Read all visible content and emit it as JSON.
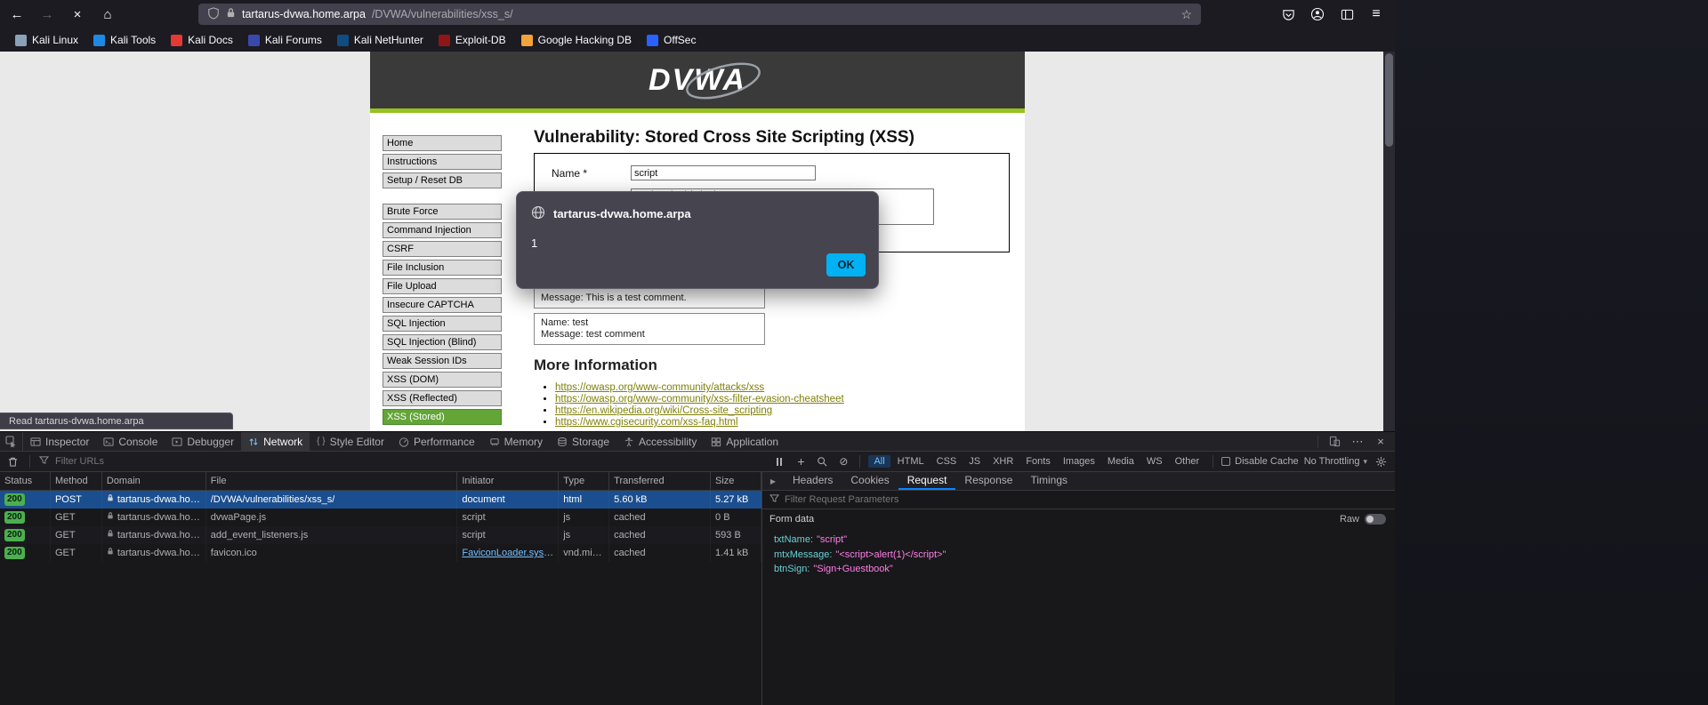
{
  "colors": {
    "accent_blue": "#0a84ff",
    "selected_row_blue": "#1b4e8f",
    "status_green": "#4caf50",
    "dvwa_green": "#97c221",
    "menu_selected_green": "#63a537",
    "link_olive": "#80800a",
    "param_key_teal": "#6ad1d6",
    "param_value_pink": "#ff7de9",
    "ok_button_blue": "#00b2f3"
  },
  "browser": {
    "url": {
      "host": "tartarus-dvwa.home.arpa",
      "path": "/DVWA/vulnerabilities/xss_s/"
    },
    "icons": {
      "back": "←",
      "forward": "→",
      "stop": "×",
      "home": "⌂",
      "star": "☆",
      "menu": "≡"
    },
    "bookmarks": [
      "Kali Linux",
      "Kali Tools",
      "Kali Docs",
      "Kali Forums",
      "Kali NetHunter",
      "Exploit-DB",
      "Google Hacking DB",
      "OffSec"
    ],
    "status_tooltip": "Read tartarus-dvwa.home.arpa"
  },
  "dialog": {
    "origin": "tartarus-dvwa.home.arpa",
    "message": "1",
    "ok_label": "OK"
  },
  "page": {
    "logo_text": "DVWA",
    "heading": "Vulnerability: Stored Cross Site Scripting (XSS)",
    "menu": [
      "Home",
      "Instructions",
      "Setup / Reset DB",
      "Brute Force",
      "Command Injection",
      "CSRF",
      "File Inclusion",
      "File Upload",
      "Insecure CAPTCHA",
      "SQL Injection",
      "SQL Injection (Blind)",
      "Weak Session IDs",
      "XSS (DOM)",
      "XSS (Reflected)",
      "XSS (Stored)"
    ],
    "form": {
      "name_label": "Name *",
      "name_value": "script",
      "message_value": "<script>alert(1)</script>"
    },
    "guestbook": {
      "entry1_line1": "Message: This is a test comment.",
      "entry2_line1": "Name: test",
      "entry2_line2": "Message: test comment"
    },
    "more_info_heading": "More Information",
    "links": [
      "https://owasp.org/www-community/attacks/xss",
      "https://owasp.org/www-community/xss-filter-evasion-cheatsheet",
      "https://en.wikipedia.org/wiki/Cross-site_scripting",
      "https://www.cgisecurity.com/xss-faq.html"
    ]
  },
  "devtools": {
    "icons": {
      "meatball": "⋯",
      "close": "×",
      "caret": "▾",
      "block": "⊘",
      "braces": "{ }",
      "play": "▶"
    },
    "tabs": [
      "Inspector",
      "Console",
      "Debugger",
      "Network",
      "Style Editor",
      "Performance",
      "Memory",
      "Storage",
      "Accessibility",
      "Application"
    ],
    "network": {
      "filter_placeholder": "Filter URLs",
      "filters": [
        "All",
        "HTML",
        "CSS",
        "JS",
        "XHR",
        "Fonts",
        "Images",
        "Media",
        "WS",
        "Other"
      ],
      "disable_cache_label": "Disable Cache",
      "throttling_label": "No Throttling",
      "columns": [
        "Status",
        "Method",
        "Domain",
        "File",
        "Initiator",
        "Type",
        "Transferred",
        "Size"
      ],
      "rows": [
        {
          "status": "200",
          "method": "POST",
          "domain": "tartarus-dvwa.home…",
          "file": "/DVWA/vulnerabilities/xss_s/",
          "initiator": "document",
          "type": "html",
          "transferred": "5.60 kB",
          "size": "5.27 kB"
        },
        {
          "status": "200",
          "method": "GET",
          "domain": "tartarus-dvwa.home…",
          "file": "dvwaPage.js",
          "initiator": "script",
          "type": "js",
          "transferred": "cached",
          "size": "0 B"
        },
        {
          "status": "200",
          "method": "GET",
          "domain": "tartarus-dvwa.home…",
          "file": "add_event_listeners.js",
          "initiator": "script",
          "type": "js",
          "transferred": "cached",
          "size": "593 B"
        },
        {
          "status": "200",
          "method": "GET",
          "domain": "tartarus-dvwa.home…",
          "file": "favicon.ico",
          "initiator": "FaviconLoader.sys.mjs:1…",
          "type": "vnd.micro…",
          "transferred": "cached",
          "size": "1.41 kB"
        }
      ]
    },
    "request_panel": {
      "tabs": [
        "Headers",
        "Cookies",
        "Request",
        "Response",
        "Timings"
      ],
      "filter_placeholder": "Filter Request Parameters",
      "section_label": "Form data",
      "raw_label": "Raw",
      "params": [
        {
          "key": "txtName:",
          "value": "\"script\""
        },
        {
          "key": "mtxMessage:",
          "value": "\"<script>alert(1)</script>\""
        },
        {
          "key": "btnSign:",
          "value": "\"Sign+Guestbook\""
        }
      ]
    }
  }
}
